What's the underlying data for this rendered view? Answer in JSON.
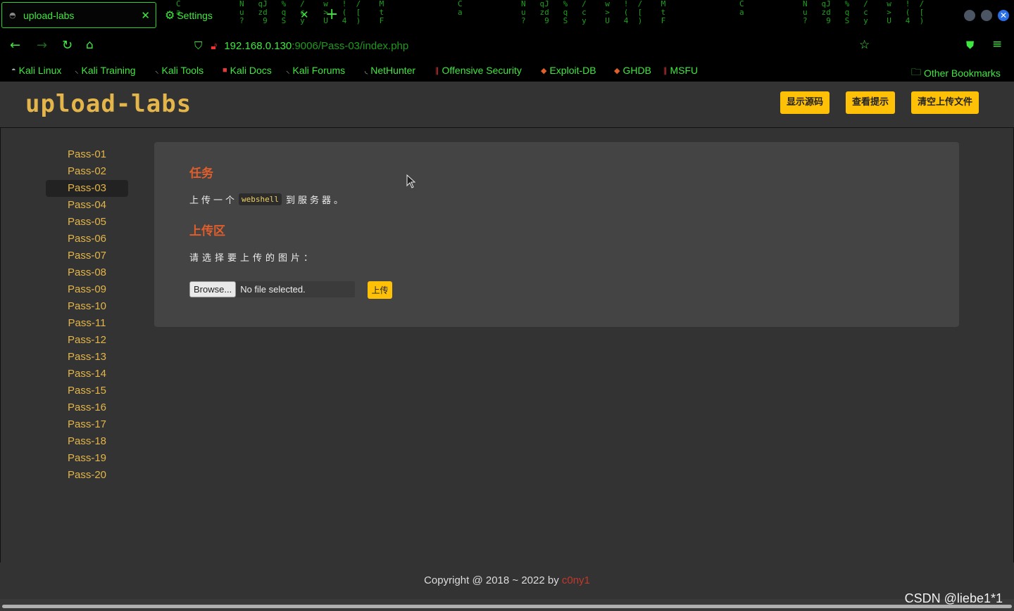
{
  "browser": {
    "tabs": [
      {
        "title": "upload-labs",
        "active": true
      },
      {
        "title": "Settings",
        "active": false
      }
    ],
    "url_host": "192.168.0.130",
    "url_rest": ":9006/Pass-03/index.php",
    "bookmarks": [
      "Kali Linux",
      "Kali Training",
      "Kali Tools",
      "Kali Docs",
      "Kali Forums",
      "NetHunter",
      "Offensive Security",
      "Exploit-DB",
      "GHDB",
      "MSFU"
    ],
    "other_bookmarks": "Other Bookmarks",
    "accent_color": "#3ee83e"
  },
  "header": {
    "logo": "upload-labs",
    "buttons": [
      "显示源码",
      "查看提示",
      "清空上传文件"
    ]
  },
  "sidebar": {
    "active": "Pass-03",
    "items": [
      "Pass-01",
      "Pass-02",
      "Pass-03",
      "Pass-04",
      "Pass-05",
      "Pass-06",
      "Pass-07",
      "Pass-08",
      "Pass-09",
      "Pass-10",
      "Pass-11",
      "Pass-12",
      "Pass-13",
      "Pass-14",
      "Pass-15",
      "Pass-16",
      "Pass-17",
      "Pass-18",
      "Pass-19",
      "Pass-20"
    ]
  },
  "content": {
    "task_heading": "任务",
    "task_prefix": "上传一个",
    "task_code": "webshell",
    "task_suffix": "到服务器。",
    "upload_heading": "上传区",
    "choose_label": "请选择要上传的图片：",
    "browse_label": "Browse...",
    "file_status": "No file selected.",
    "submit_label": "上传"
  },
  "footer": {
    "copyright": "Copyright @ 2018 ~ 2022 by ",
    "author": "c0ny1"
  },
  "watermark": "CSDN @liebe1*1"
}
